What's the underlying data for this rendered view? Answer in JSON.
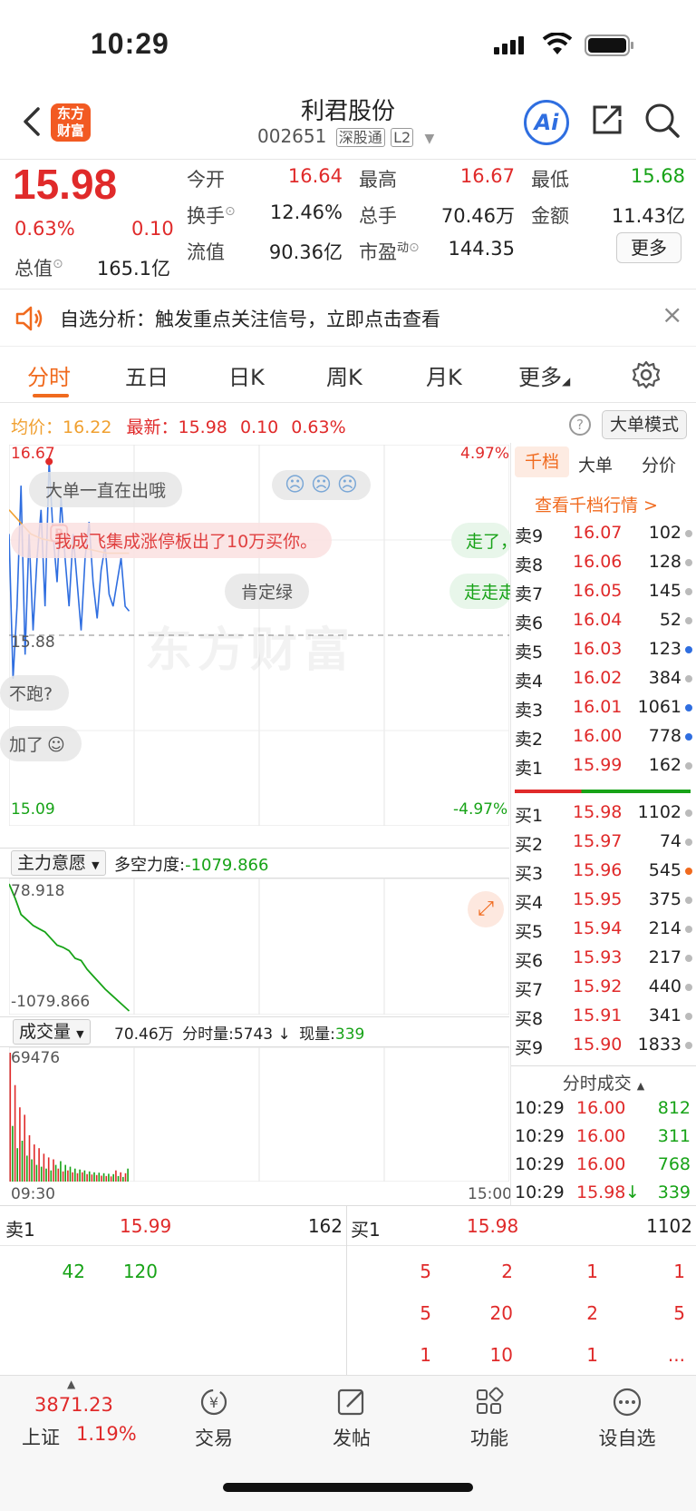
{
  "status_bar": {
    "time": "10:29"
  },
  "header": {
    "back_icon": "chevron-left-icon",
    "brand_logo": "东方财富",
    "stock_name": "利君股份",
    "stock_code": "002651",
    "tag_exchange": "深股通",
    "tag_level": "L2",
    "ai_label": "Ai",
    "share_icon": "share-icon",
    "search_icon": "search-icon"
  },
  "quote": {
    "price": "15.98",
    "change_pct": "0.63%",
    "change_abs": "0.10",
    "total_mv_label": "总值",
    "total_mv": "165.1亿",
    "fields": {
      "open_label": "今开",
      "open": "16.64",
      "high_label": "最高",
      "high": "16.67",
      "low_label": "最低",
      "low": "15.68",
      "turnover_label": "换手",
      "turnover": "12.46%",
      "volume_label": "总手",
      "volume": "70.46万",
      "amount_label": "金额",
      "amount": "11.43亿",
      "float_label": "流值",
      "float": "90.36亿",
      "pe_label": "市盈",
      "pe_sup": "动",
      "pe": "144.35"
    },
    "more_button": "更多"
  },
  "notice": {
    "text": "自选分析：触发重点关注信号，立即点击查看",
    "close": "×"
  },
  "tabs": [
    "分时",
    "五日",
    "日K",
    "周K",
    "月K",
    "更多"
  ],
  "chart_header": {
    "avg_label": "均价：",
    "avg": "16.22",
    "last_label": "最新：",
    "last": "15.98",
    "chg": "0.10",
    "pct": "0.63%",
    "big_order_mode": "大单模式"
  },
  "chart_data": {
    "type": "line",
    "y_top": "16.67",
    "y_mid": "15.88",
    "y_bottom": "15.09",
    "pct_top": "4.97%",
    "pct_bottom": "-4.97%",
    "x_start": "09:30",
    "x_end": "15:00",
    "price": [
      16.3,
      15.7,
      16.0,
      16.5,
      15.8,
      16.3,
      15.9,
      16.2,
      16.4,
      16.0,
      16.6,
      16.3,
      16.1,
      16.45,
      16.2,
      16.0,
      16.3,
      16.1,
      15.9,
      16.2,
      16.35,
      16.1,
      15.95,
      16.15,
      16.25,
      16.05,
      16.0,
      16.1,
      16.2,
      16.0,
      15.98
    ],
    "avg_line": [
      16.4,
      16.35,
      16.3,
      16.28,
      16.27,
      16.26,
      16.25,
      16.24,
      16.23,
      16.22,
      16.22,
      16.22
    ],
    "indicator": {
      "label": "主力意愿",
      "ls_label": "多空力度:",
      "ls_value": "-1079.866",
      "top": "78.918",
      "bottom": "-1079.866",
      "values": [
        78.9,
        -50,
        -200,
        -250,
        -300,
        -330,
        -360,
        -420,
        -480,
        -500,
        -530,
        -600,
        -620,
        -700,
        -760,
        -820,
        -880,
        -930,
        -980,
        -1030,
        -1079.9
      ]
    },
    "volume": {
      "label": "成交量",
      "total": "70.46万",
      "min_label": "分时量:",
      "min_vol": "5743",
      "arrow": "↓",
      "now_label": "现量:",
      "now_vol": "339",
      "top": "69476",
      "bars": [
        69476,
        30000,
        52000,
        18000,
        40000,
        22000,
        36000,
        14000,
        25000,
        12000,
        20000,
        9000,
        18000,
        8000,
        15000,
        7000,
        13000,
        6000,
        12000,
        9000,
        7000,
        11000,
        5500,
        9000,
        6000,
        8000,
        5000,
        7000,
        4500,
        6500,
        5000,
        6000,
        4000,
        5500,
        3800,
        5000,
        3500,
        4800,
        3200,
        4500,
        3000,
        4200,
        2800,
        4000,
        6000,
        3000,
        5000,
        2500,
        4500,
        7000
      ]
    }
  },
  "bubbles": [
    "大单一直在出哦",
    "我成飞集成涨停板出了10万买你。",
    "肯定绿",
    "走了，",
    "走走走",
    "不跑?",
    "加了"
  ],
  "order_book": {
    "tabs": [
      "千档",
      "大单",
      "分价"
    ],
    "link": "查看千档行情 >",
    "asks": [
      {
        "label": "卖9",
        "price": "16.07",
        "vol": "102",
        "dot": "gray"
      },
      {
        "label": "卖8",
        "price": "16.06",
        "vol": "128",
        "dot": "gray"
      },
      {
        "label": "卖7",
        "price": "16.05",
        "vol": "145",
        "dot": "gray"
      },
      {
        "label": "卖6",
        "price": "16.04",
        "vol": "52",
        "dot": "gray"
      },
      {
        "label": "卖5",
        "price": "16.03",
        "vol": "123",
        "dot": "blue"
      },
      {
        "label": "卖4",
        "price": "16.02",
        "vol": "384",
        "dot": "gray"
      },
      {
        "label": "卖3",
        "price": "16.01",
        "vol": "1061",
        "dot": "blue"
      },
      {
        "label": "卖2",
        "price": "16.00",
        "vol": "778",
        "dot": "blue"
      },
      {
        "label": "卖1",
        "price": "15.99",
        "vol": "162",
        "dot": "gray"
      }
    ],
    "bids": [
      {
        "label": "买1",
        "price": "15.98",
        "vol": "1102",
        "dot": "gray"
      },
      {
        "label": "买2",
        "price": "15.97",
        "vol": "74",
        "dot": "gray"
      },
      {
        "label": "买3",
        "price": "15.96",
        "vol": "545",
        "dot": "orange"
      },
      {
        "label": "买4",
        "price": "15.95",
        "vol": "375",
        "dot": "gray"
      },
      {
        "label": "买5",
        "price": "15.94",
        "vol": "214",
        "dot": "gray"
      },
      {
        "label": "买6",
        "price": "15.93",
        "vol": "217",
        "dot": "gray"
      },
      {
        "label": "买7",
        "price": "15.92",
        "vol": "440",
        "dot": "gray"
      },
      {
        "label": "买8",
        "price": "15.91",
        "vol": "341",
        "dot": "gray"
      },
      {
        "label": "买9",
        "price": "15.90",
        "vol": "1833",
        "dot": "gray"
      }
    ],
    "ticks_title": "分时成交",
    "ticks": [
      {
        "time": "10:29",
        "price": "16.00",
        "vol": "812",
        "arrow": ""
      },
      {
        "time": "10:29",
        "price": "16.00",
        "vol": "311",
        "arrow": ""
      },
      {
        "time": "10:29",
        "price": "16.00",
        "vol": "768",
        "arrow": ""
      },
      {
        "time": "10:29",
        "price": "15.98",
        "vol": "339",
        "arrow": "↓"
      }
    ]
  },
  "queue": {
    "ask_label": "卖1",
    "ask_price": "15.99",
    "ask_vol": "162",
    "bid_label": "买1",
    "bid_price": "15.98",
    "bid_vol": "1102",
    "ask_rows": [
      [
        "42",
        "120"
      ]
    ],
    "bid_rows": [
      [
        "5",
        "2",
        "1",
        "1"
      ],
      [
        "5",
        "20",
        "2",
        "5"
      ],
      [
        "1",
        "10",
        "1",
        "..."
      ]
    ]
  },
  "bottom_nav": {
    "index_value": "3871.23",
    "index_name": "上证",
    "index_pct": "1.19%",
    "items": [
      "交易",
      "发帖",
      "功能",
      "设自选"
    ]
  },
  "colors": {
    "up": "#e02a2a",
    "down": "#17a317",
    "accent": "#f06a1e",
    "avg_line": "#f0a030",
    "price_line": "#2f6ee0"
  }
}
